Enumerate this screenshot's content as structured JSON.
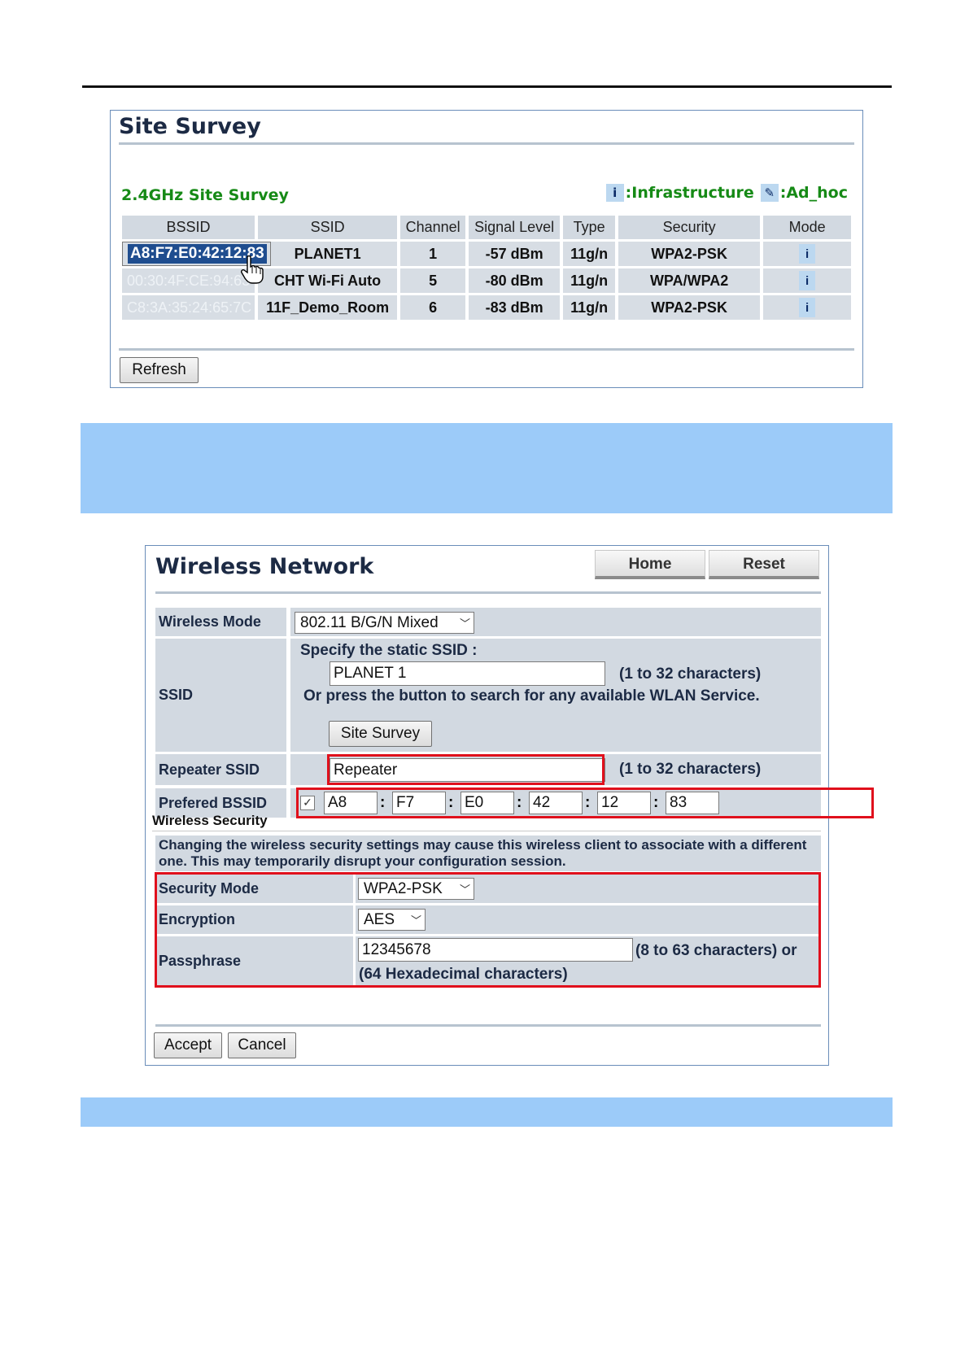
{
  "site_survey": {
    "title": "Site Survey",
    "band_label": "2.4GHz Site Survey",
    "legend_infrastructure": ":Infrastructure",
    "legend_adhoc": ":Ad_hoc",
    "columns": [
      "BSSID",
      "SSID",
      "Channel",
      "Signal Level",
      "Type",
      "Security",
      "Mode"
    ],
    "rows": [
      {
        "bssid": "A8:F7:E0:42:12:83",
        "ssid": "PLANET1",
        "channel": "1",
        "signal": "-57 dBm",
        "type": "11g/n",
        "security": "WPA2-PSK"
      },
      {
        "bssid": "00:30:4F:CE:94:63",
        "ssid": "CHT Wi-Fi Auto",
        "channel": "5",
        "signal": "-80 dBm",
        "type": "11g/n",
        "security": "WPA/WPA2"
      },
      {
        "bssid": "C8:3A:35:24:65:7C",
        "ssid": "11F_Demo_Room",
        "channel": "6",
        "signal": "-83 dBm",
        "type": "11g/n",
        "security": "WPA2-PSK"
      }
    ],
    "refresh_label": "Refresh"
  },
  "wireless_network": {
    "title": "Wireless Network",
    "home_label": "Home",
    "reset_label": "Reset",
    "wireless_mode_label": "Wireless Mode",
    "wireless_mode_value": "802.11 B/G/N Mixed",
    "ssid_label": "SSID",
    "ssid_specify": "Specify the static SSID  :",
    "ssid_value": "PLANET 1",
    "ssid_hint": "(1 to 32 characters)",
    "ssid_or_press": "Or press the button to search for any available WLAN Service.",
    "site_survey_button": "Site Survey",
    "repeater_ssid_label": "Repeater SSID",
    "repeater_ssid_value": "Repeater",
    "repeater_ssid_hint": "(1 to 32 characters)",
    "preferred_bssid_label": "Prefered BSSID",
    "preferred_bssid_checked": true,
    "bssid_octets": [
      "A8",
      "F7",
      "E0",
      "42",
      "12",
      "83"
    ],
    "wireless_security_heading": "Wireless Security",
    "security_note": "Changing the wireless security settings may cause this wireless client to associate with a different one. This may temporarily disrupt your configuration session.",
    "security_mode_label": "Security Mode",
    "security_mode_value": "WPA2-PSK",
    "encryption_label": "Encryption",
    "encryption_value": "AES",
    "passphrase_label": "Passphrase",
    "passphrase_value": "12345678",
    "passphrase_hint": "(8 to 63 characters) or",
    "passphrase_hint2": "(64 Hexadecimal characters)",
    "accept_label": "Accept",
    "cancel_label": "Cancel"
  },
  "colors": {
    "highlight_red": "#e0101c",
    "band_blue": "#9ccbf9",
    "title_green": "#168a16"
  }
}
